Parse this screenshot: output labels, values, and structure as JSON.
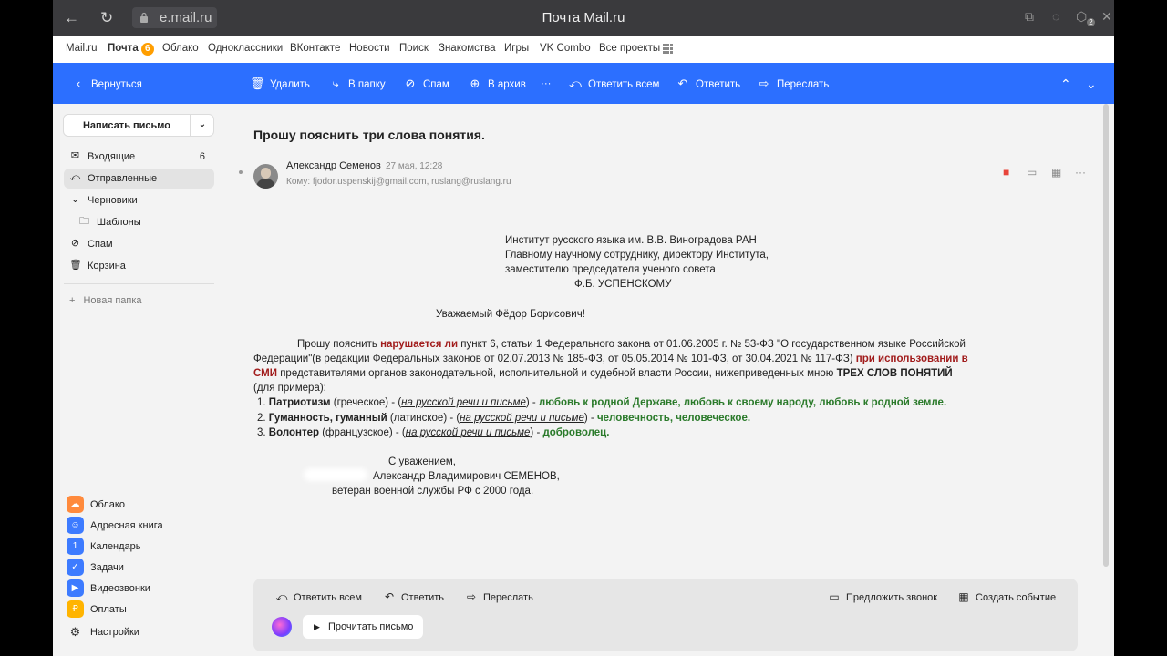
{
  "browser": {
    "url": "e.mail.ru",
    "title": "Почта Mail.ru",
    "ext_badge": "2"
  },
  "portal": {
    "links": [
      "Mail.ru",
      "Почта",
      "Облако",
      "Одноклассники",
      "ВКонтакте",
      "Новости",
      "Поиск",
      "Знакомства",
      "Игры",
      "VK Combo",
      "Все проекты"
    ],
    "mail_badge": "6"
  },
  "toolbar": {
    "back": "Вернуться",
    "delete": "Удалить",
    "to_folder": "В папку",
    "spam": "Спам",
    "archive": "В архив",
    "more": "···",
    "reply_all": "Ответить всем",
    "reply": "Ответить",
    "forward": "Переслать"
  },
  "sidebar": {
    "compose": "Написать письмо",
    "folders": [
      {
        "label": "Входящие",
        "count": "6"
      },
      {
        "label": "Отправленные",
        "count": ""
      },
      {
        "label": "Черновики",
        "count": ""
      },
      {
        "label": "Шаблоны",
        "count": ""
      },
      {
        "label": "Спам",
        "count": ""
      },
      {
        "label": "Корзина",
        "count": ""
      }
    ],
    "new_folder": "Новая папка",
    "apps": [
      {
        "label": "Облако",
        "color": "#ff8a3c"
      },
      {
        "label": "Адресная книга",
        "color": "#3d7bff"
      },
      {
        "label": "Календарь",
        "color": "#3d7bff"
      },
      {
        "label": "Задачи",
        "color": "#3d7bff"
      },
      {
        "label": "Видеозвонки",
        "color": "#3d7bff"
      },
      {
        "label": "Оплаты",
        "color": "#ffb400"
      },
      {
        "label": "Настройки",
        "color": "#333333"
      }
    ]
  },
  "message": {
    "subject": "Прошу пояснить три слова понятия.",
    "sender": "Александр Семенов",
    "date": "27 мая, 12:28",
    "recipients": "Кому: fjodor.uspenskij@gmail.com,  ruslang@ruslang.ru",
    "addr": [
      "Институт русского языка им. В.В. Виноградова РАН",
      "Главному научному сотруднику, директору Института,",
      "заместителю председателя ученого совета",
      "Ф.Б. УСПЕНСКОМУ"
    ],
    "greeting": "Уважаемый Фёдор Борисович!",
    "p1_a": "Прошу пояснить ",
    "p1_b": "нарушается ли",
    "p1_c": " пункт 6, статьи 1 Федерального закона от 01.06.2005 г. № 53-ФЗ \"О государственном языке Российской",
    "p2_a": "Федерации\"(в редакции Федеральных законов от 02.07.2013 № 185-ФЗ, от 05.05.2014 № 101-ФЗ, от 30.04.2021 № 117-ФЗ) ",
    "p2_b": "при использовании в",
    "p3_a": "СМИ",
    "p3_b": " представителями органов законодательной, исполнительной и судебной власти России, нижеприведенных мною ",
    "p3_c": "ТРЕХ СЛОВ ПОНЯТИЙ",
    "p4": "(для примера):",
    "items": [
      {
        "num": "1. ",
        "word": "Патриотизм",
        "origin": " (греческое) - (",
        "usage": "на русской речи и письме",
        "close": ") - ",
        "meaning": "любовь к родной Державе, любовь к своему народу, любовь к родной земле."
      },
      {
        "num": "2. ",
        "word": "Гуманность, гуманный",
        "origin": " (латинское) - (",
        "usage": "на русской речи и письме",
        "close": ") - ",
        "meaning": "человечность, человеческое."
      },
      {
        "num": "3. ",
        "word": "Волонтер",
        "origin": " (французское) - (",
        "usage": "на русской речи и письме",
        "close": ") - ",
        "meaning": "доброволец."
      }
    ],
    "sign": [
      "С уважением,",
      "Александр Владимирович СЕМЕНОВ,",
      "ветеран военной службы РФ с 2000 года."
    ]
  },
  "reply_panel": {
    "reply_all": "Ответить всем",
    "reply": "Ответить",
    "forward": "Переслать",
    "propose_call": "Предложить звонок",
    "create_event": "Создать событие",
    "read_letter": "Прочитать письмо"
  },
  "colors": {
    "accent": "#2c6fff",
    "emphasis_red": "#a11c1c",
    "emphasis_green": "#2a7a2a"
  }
}
